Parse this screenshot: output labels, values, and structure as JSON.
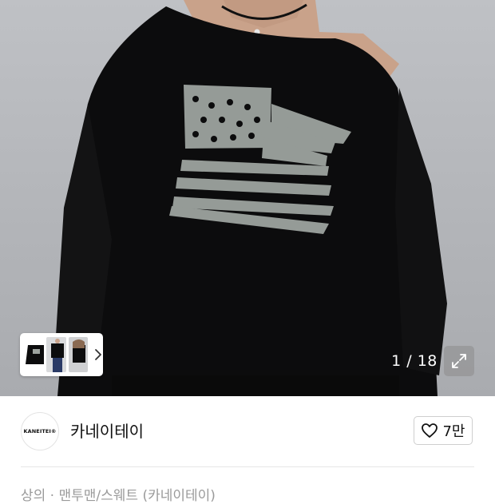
{
  "gallery": {
    "counter": "1 / 18",
    "thumbnails": [
      "thumb-sweatshirt-flat",
      "thumb-model-front",
      "thumb-model-side"
    ],
    "next_icon": "chevron-right-icon",
    "expand_icon": "expand-icon"
  },
  "store": {
    "logo_text": "KANEITEI®",
    "name": "카네이테이",
    "like_icon": "heart-outline-icon",
    "like_count": "7만"
  },
  "breadcrumb": {
    "text": "상의 · 맨투맨/스웨트 (카네이테이)"
  },
  "colors": {
    "background": "#ffffff",
    "photo_background": "#b5b7bb",
    "garment": "#0c0c0d",
    "print": "#9da39f",
    "muted_text": "#9a9a9a"
  }
}
